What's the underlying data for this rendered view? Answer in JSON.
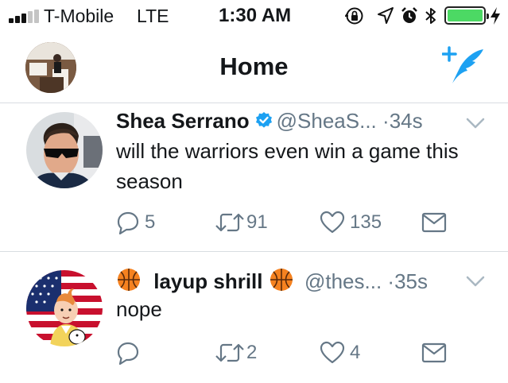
{
  "status_bar": {
    "carrier": "T-Mobile",
    "network": "LTE",
    "time": "1:30 AM",
    "signal_bars_active": 3,
    "signal_bars_total": 5,
    "battery_level": 1.0,
    "battery_color": "#4cd964",
    "icons": [
      "orientation-lock-icon",
      "location-arrow-icon",
      "alarm-icon",
      "bluetooth-icon",
      "battery-icon",
      "charging-bolt-icon"
    ]
  },
  "header": {
    "title": "Home",
    "compose_icon": "compose-tweet-icon",
    "accent_color": "#1da1f2"
  },
  "tweets": [
    {
      "name": "Shea Serrano",
      "verified": true,
      "handle": "@SheaS...",
      "time": "34s",
      "text": "will the warriors even win a game this season",
      "replies": "5",
      "retweets": "91",
      "likes": "135"
    },
    {
      "name": "layup shrill",
      "name_emoji": "basketball-emoji-icon",
      "verified": false,
      "handle": "@thes...",
      "time": "35s",
      "text": "nope",
      "replies": "",
      "retweets": "2",
      "likes": "4"
    }
  ],
  "separator": "·"
}
